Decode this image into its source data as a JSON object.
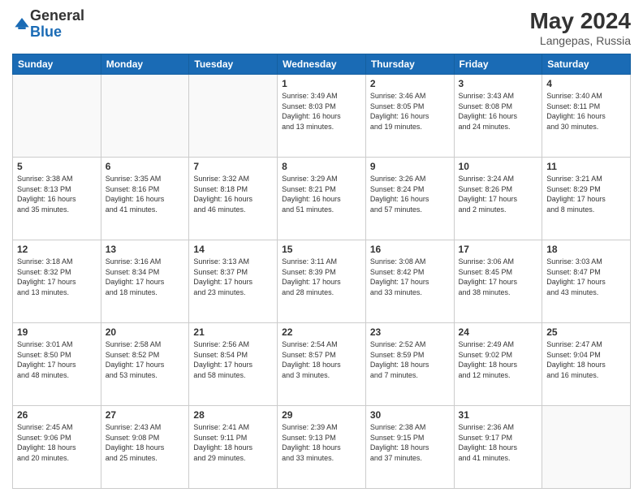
{
  "header": {
    "logo_general": "General",
    "logo_blue": "Blue",
    "month_year": "May 2024",
    "location": "Langepas, Russia"
  },
  "days_of_week": [
    "Sunday",
    "Monday",
    "Tuesday",
    "Wednesday",
    "Thursday",
    "Friday",
    "Saturday"
  ],
  "weeks": [
    [
      {
        "day": "",
        "info": ""
      },
      {
        "day": "",
        "info": ""
      },
      {
        "day": "",
        "info": ""
      },
      {
        "day": "1",
        "info": "Sunrise: 3:49 AM\nSunset: 8:03 PM\nDaylight: 16 hours\nand 13 minutes."
      },
      {
        "day": "2",
        "info": "Sunrise: 3:46 AM\nSunset: 8:05 PM\nDaylight: 16 hours\nand 19 minutes."
      },
      {
        "day": "3",
        "info": "Sunrise: 3:43 AM\nSunset: 8:08 PM\nDaylight: 16 hours\nand 24 minutes."
      },
      {
        "day": "4",
        "info": "Sunrise: 3:40 AM\nSunset: 8:11 PM\nDaylight: 16 hours\nand 30 minutes."
      }
    ],
    [
      {
        "day": "5",
        "info": "Sunrise: 3:38 AM\nSunset: 8:13 PM\nDaylight: 16 hours\nand 35 minutes."
      },
      {
        "day": "6",
        "info": "Sunrise: 3:35 AM\nSunset: 8:16 PM\nDaylight: 16 hours\nand 41 minutes."
      },
      {
        "day": "7",
        "info": "Sunrise: 3:32 AM\nSunset: 8:18 PM\nDaylight: 16 hours\nand 46 minutes."
      },
      {
        "day": "8",
        "info": "Sunrise: 3:29 AM\nSunset: 8:21 PM\nDaylight: 16 hours\nand 51 minutes."
      },
      {
        "day": "9",
        "info": "Sunrise: 3:26 AM\nSunset: 8:24 PM\nDaylight: 16 hours\nand 57 minutes."
      },
      {
        "day": "10",
        "info": "Sunrise: 3:24 AM\nSunset: 8:26 PM\nDaylight: 17 hours\nand 2 minutes."
      },
      {
        "day": "11",
        "info": "Sunrise: 3:21 AM\nSunset: 8:29 PM\nDaylight: 17 hours\nand 8 minutes."
      }
    ],
    [
      {
        "day": "12",
        "info": "Sunrise: 3:18 AM\nSunset: 8:32 PM\nDaylight: 17 hours\nand 13 minutes."
      },
      {
        "day": "13",
        "info": "Sunrise: 3:16 AM\nSunset: 8:34 PM\nDaylight: 17 hours\nand 18 minutes."
      },
      {
        "day": "14",
        "info": "Sunrise: 3:13 AM\nSunset: 8:37 PM\nDaylight: 17 hours\nand 23 minutes."
      },
      {
        "day": "15",
        "info": "Sunrise: 3:11 AM\nSunset: 8:39 PM\nDaylight: 17 hours\nand 28 minutes."
      },
      {
        "day": "16",
        "info": "Sunrise: 3:08 AM\nSunset: 8:42 PM\nDaylight: 17 hours\nand 33 minutes."
      },
      {
        "day": "17",
        "info": "Sunrise: 3:06 AM\nSunset: 8:45 PM\nDaylight: 17 hours\nand 38 minutes."
      },
      {
        "day": "18",
        "info": "Sunrise: 3:03 AM\nSunset: 8:47 PM\nDaylight: 17 hours\nand 43 minutes."
      }
    ],
    [
      {
        "day": "19",
        "info": "Sunrise: 3:01 AM\nSunset: 8:50 PM\nDaylight: 17 hours\nand 48 minutes."
      },
      {
        "day": "20",
        "info": "Sunrise: 2:58 AM\nSunset: 8:52 PM\nDaylight: 17 hours\nand 53 minutes."
      },
      {
        "day": "21",
        "info": "Sunrise: 2:56 AM\nSunset: 8:54 PM\nDaylight: 17 hours\nand 58 minutes."
      },
      {
        "day": "22",
        "info": "Sunrise: 2:54 AM\nSunset: 8:57 PM\nDaylight: 18 hours\nand 3 minutes."
      },
      {
        "day": "23",
        "info": "Sunrise: 2:52 AM\nSunset: 8:59 PM\nDaylight: 18 hours\nand 7 minutes."
      },
      {
        "day": "24",
        "info": "Sunrise: 2:49 AM\nSunset: 9:02 PM\nDaylight: 18 hours\nand 12 minutes."
      },
      {
        "day": "25",
        "info": "Sunrise: 2:47 AM\nSunset: 9:04 PM\nDaylight: 18 hours\nand 16 minutes."
      }
    ],
    [
      {
        "day": "26",
        "info": "Sunrise: 2:45 AM\nSunset: 9:06 PM\nDaylight: 18 hours\nand 20 minutes."
      },
      {
        "day": "27",
        "info": "Sunrise: 2:43 AM\nSunset: 9:08 PM\nDaylight: 18 hours\nand 25 minutes."
      },
      {
        "day": "28",
        "info": "Sunrise: 2:41 AM\nSunset: 9:11 PM\nDaylight: 18 hours\nand 29 minutes."
      },
      {
        "day": "29",
        "info": "Sunrise: 2:39 AM\nSunset: 9:13 PM\nDaylight: 18 hours\nand 33 minutes."
      },
      {
        "day": "30",
        "info": "Sunrise: 2:38 AM\nSunset: 9:15 PM\nDaylight: 18 hours\nand 37 minutes."
      },
      {
        "day": "31",
        "info": "Sunrise: 2:36 AM\nSunset: 9:17 PM\nDaylight: 18 hours\nand 41 minutes."
      },
      {
        "day": "",
        "info": ""
      }
    ]
  ]
}
